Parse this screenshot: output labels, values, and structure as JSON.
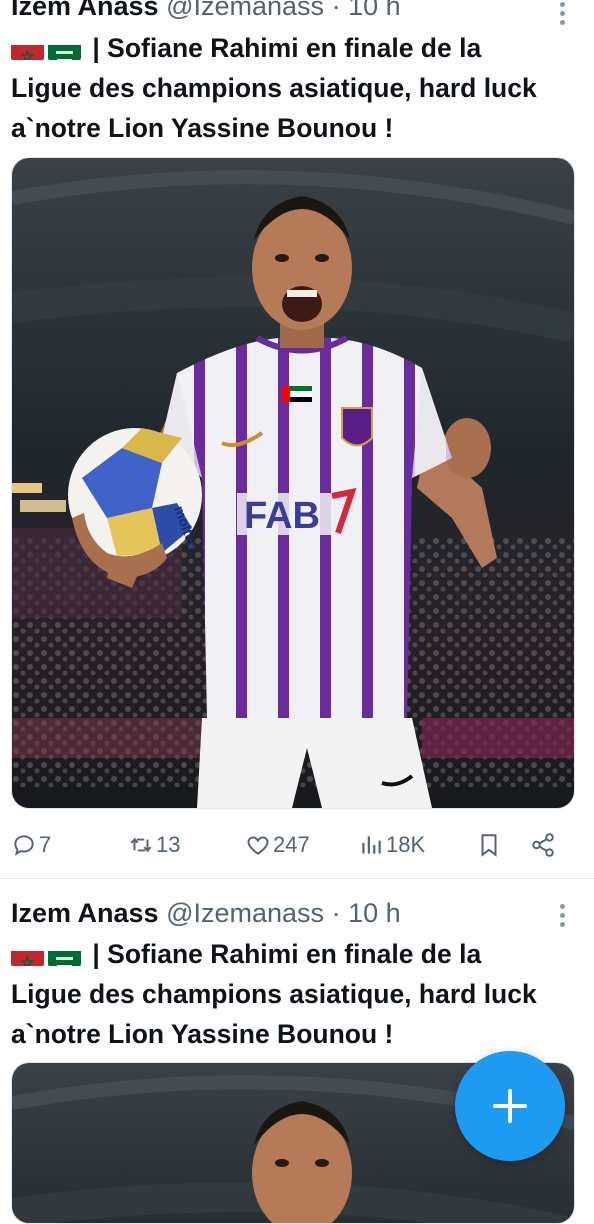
{
  "colors": {
    "accent": "#1d9bf0",
    "text": "#0f1419",
    "muted": "#536471"
  },
  "tweets": [
    {
      "author_name": "Izem Anass",
      "handle": "@Izemanass",
      "separator": "·",
      "time": "10 h",
      "flags": [
        "morocco-flag",
        "saudi-flag"
      ],
      "text": "| Sofiane Rahimi en finale de la Ligue des champions asiatique, hard luck a`notre Lion Yassine Bounou !",
      "image": {
        "jersey_sponsor": "FAB",
        "ball_brand": "molten"
      },
      "actions": {
        "replies": "7",
        "reposts": "13",
        "likes": "247",
        "views": "18K"
      }
    },
    {
      "author_name": "Izem Anass",
      "handle": "@Izemanass",
      "separator": "·",
      "time": "10 h",
      "flags": [
        "morocco-flag",
        "saudi-flag"
      ],
      "text": "| Sofiane Rahimi en finale de la Ligue des champions asiatique, hard luck a`notre Lion Yassine Bounou !"
    }
  ],
  "fab": {
    "icon": "plus-icon"
  }
}
